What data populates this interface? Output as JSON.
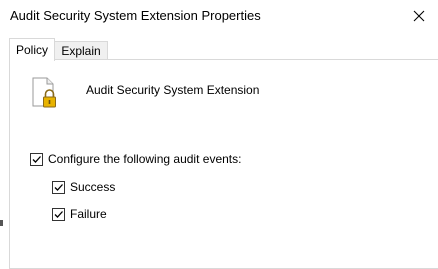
{
  "window": {
    "title": "Audit Security System Extension Properties",
    "close_icon": "close-icon"
  },
  "tabs": [
    {
      "label": "Policy",
      "active": true
    },
    {
      "label": "Explain",
      "active": false
    }
  ],
  "policy": {
    "icon": "locked-document-icon",
    "name": "Audit Security System Extension",
    "configure_label": "Configure the following audit events:",
    "configure_checked": true,
    "events": [
      {
        "label": "Success",
        "checked": true
      },
      {
        "label": "Failure",
        "checked": true
      }
    ]
  }
}
